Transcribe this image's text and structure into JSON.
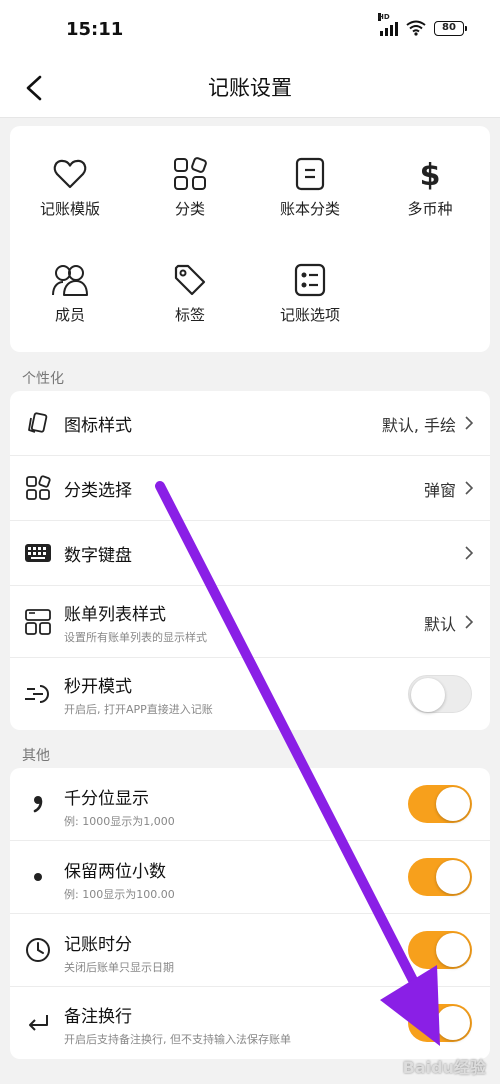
{
  "status_bar": {
    "time": "15:11",
    "network": "HD",
    "battery": "80"
  },
  "header": {
    "title": "记账设置"
  },
  "grid": [
    {
      "icon": "heart-icon",
      "label": "记账模版"
    },
    {
      "icon": "category-grid-icon",
      "label": "分类"
    },
    {
      "icon": "ledger-book-icon",
      "label": "账本分类"
    },
    {
      "icon": "dollar-icon",
      "label": "多币种"
    },
    {
      "icon": "members-icon",
      "label": "成员"
    },
    {
      "icon": "tag-icon",
      "label": "标签"
    },
    {
      "icon": "checklist-icon",
      "label": "记账选项"
    }
  ],
  "personalization": {
    "label": "个性化",
    "rows": [
      {
        "icon": "icon-style-icon",
        "title": "图标样式",
        "value": "默认, 手绘"
      },
      {
        "icon": "category-select-icon",
        "title": "分类选择",
        "value": "弹窗"
      },
      {
        "icon": "keyboard-icon",
        "title": "数字键盘"
      },
      {
        "icon": "list-style-icon",
        "title": "账单列表样式",
        "subtitle": "设置所有账单列表的显示样式",
        "value": "默认"
      },
      {
        "icon": "quick-open-icon",
        "title": "秒开模式",
        "subtitle": "开启后, 打开APP直接进入记账",
        "toggle": false
      }
    ]
  },
  "other": {
    "label": "其他",
    "rows": [
      {
        "icon": "comma-icon",
        "title": "千分位显示",
        "subtitle": "例: 1000显示为1,000",
        "toggle": true
      },
      {
        "icon": "dot-icon",
        "title": "保留两位小数",
        "subtitle": "例: 100显示为100.00",
        "toggle": true
      },
      {
        "icon": "clock-icon",
        "title": "记账时分",
        "subtitle": "关闭后账单只显示日期",
        "toggle": true
      },
      {
        "icon": "return-icon",
        "title": "备注换行",
        "subtitle": "开启后支持备注换行, 但不支持输入法保存账单",
        "toggle": true
      }
    ]
  },
  "colors": {
    "accent": "#f7a01c",
    "arrow": "#8a1fe6"
  },
  "watermark": "Baidu经验"
}
